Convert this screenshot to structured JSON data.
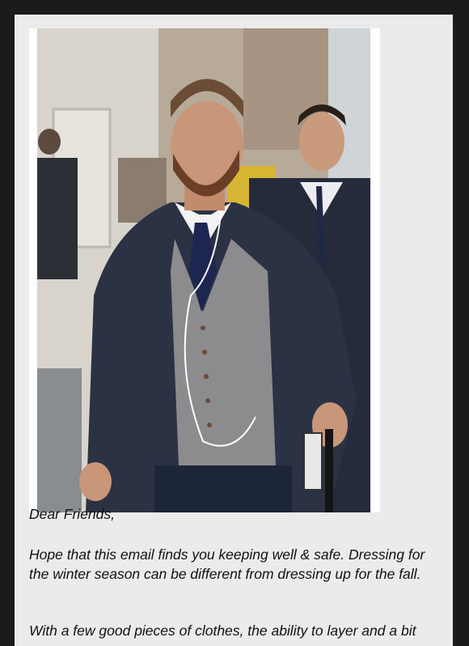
{
  "email": {
    "greeting": "Dear Friends,",
    "paragraph_1": "Hope that this email finds you keeping well & safe. Dressing for the winter season can be different from dressing up for the fall.",
    "paragraph_2_partial": "With a few good pieces of clothes, the ability to layer and a bit"
  },
  "image": {
    "semantic": "man-in-three-piece-suit-photo"
  },
  "colors": {
    "page_background": "#1b1b1b",
    "card_background": "#ebebeb",
    "text": "#111111"
  }
}
